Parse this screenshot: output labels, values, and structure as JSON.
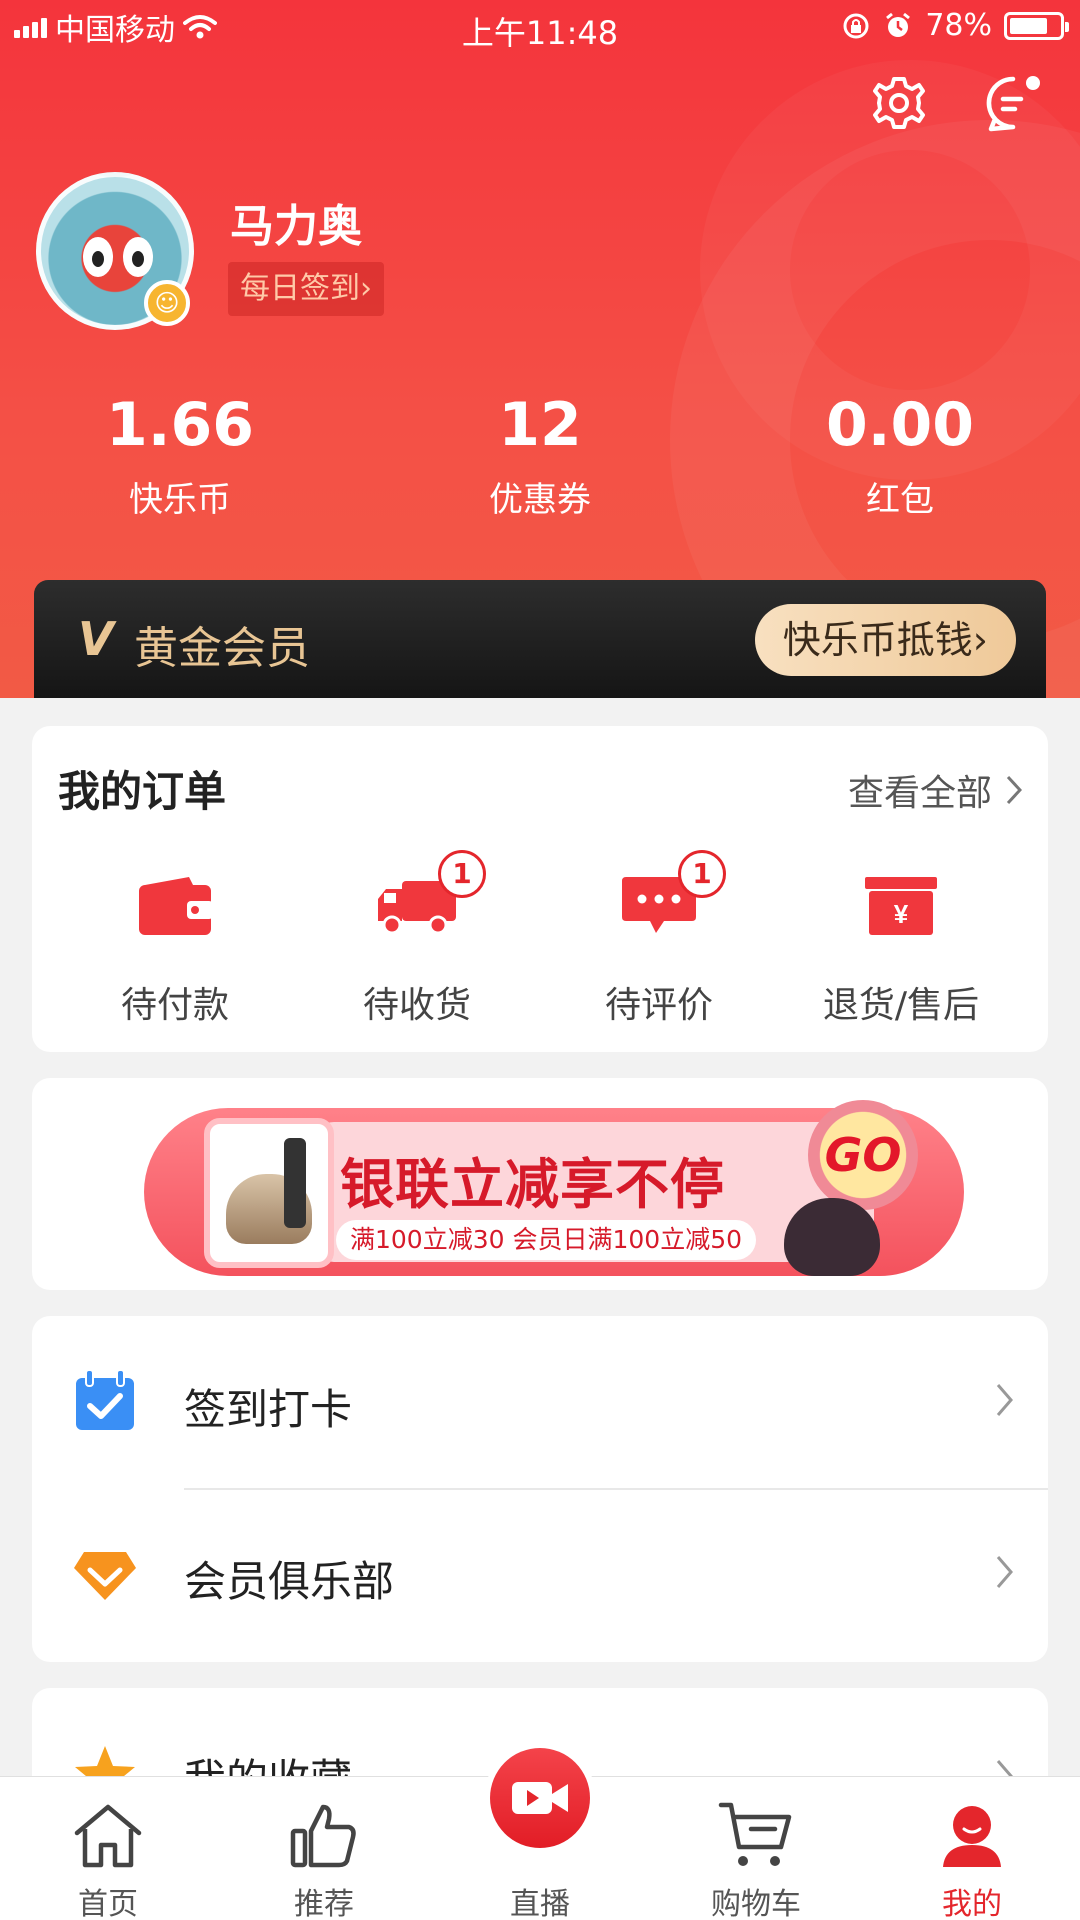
{
  "status_bar": {
    "carrier": "中国移动",
    "time": "上午11:48",
    "battery": "78%",
    "battery_level": 0.78
  },
  "header": {
    "settings_icon": "gear-icon",
    "message_icon": "chat-bubble-icon",
    "username": "马力奥",
    "signin_label": "每日签到›"
  },
  "stats": [
    {
      "value": "1.66",
      "label": "快乐币"
    },
    {
      "value": "12",
      "label": "优惠券"
    },
    {
      "value": "0.00",
      "label": "红包"
    }
  ],
  "vip": {
    "logo": "V",
    "title": "黄金会员",
    "button": "快乐币抵钱›"
  },
  "orders": {
    "title": "我的订单",
    "view_all": "查看全部",
    "items": [
      {
        "label": "待付款",
        "icon": "wallet-icon",
        "badge": ""
      },
      {
        "label": "待收货",
        "icon": "truck-icon",
        "badge": "1"
      },
      {
        "label": "待评价",
        "icon": "comment-icon",
        "badge": "1"
      },
      {
        "label": "退货/售后",
        "icon": "refund-box-icon",
        "badge": ""
      }
    ]
  },
  "promo": {
    "title": "银联立减享不停",
    "subtitle": "满100立减30 会员日满100立减50",
    "go": "GO"
  },
  "menu": [
    {
      "label": "签到打卡",
      "icon": "calendar-check-icon"
    },
    {
      "label": "会员俱乐部",
      "icon": "diamond-icon"
    },
    {
      "label": "我的收藏",
      "icon": "star-icon"
    }
  ],
  "tabbar": [
    {
      "label": "首页",
      "icon": "home-icon"
    },
    {
      "label": "推荐",
      "icon": "thumbs-up-icon"
    },
    {
      "label": "直播",
      "icon": "video-camera-icon"
    },
    {
      "label": "购物车",
      "icon": "cart-icon"
    },
    {
      "label": "我的",
      "icon": "user-icon"
    }
  ],
  "colors": {
    "brand_red": "#e4262c",
    "gold": "#e8c594"
  }
}
